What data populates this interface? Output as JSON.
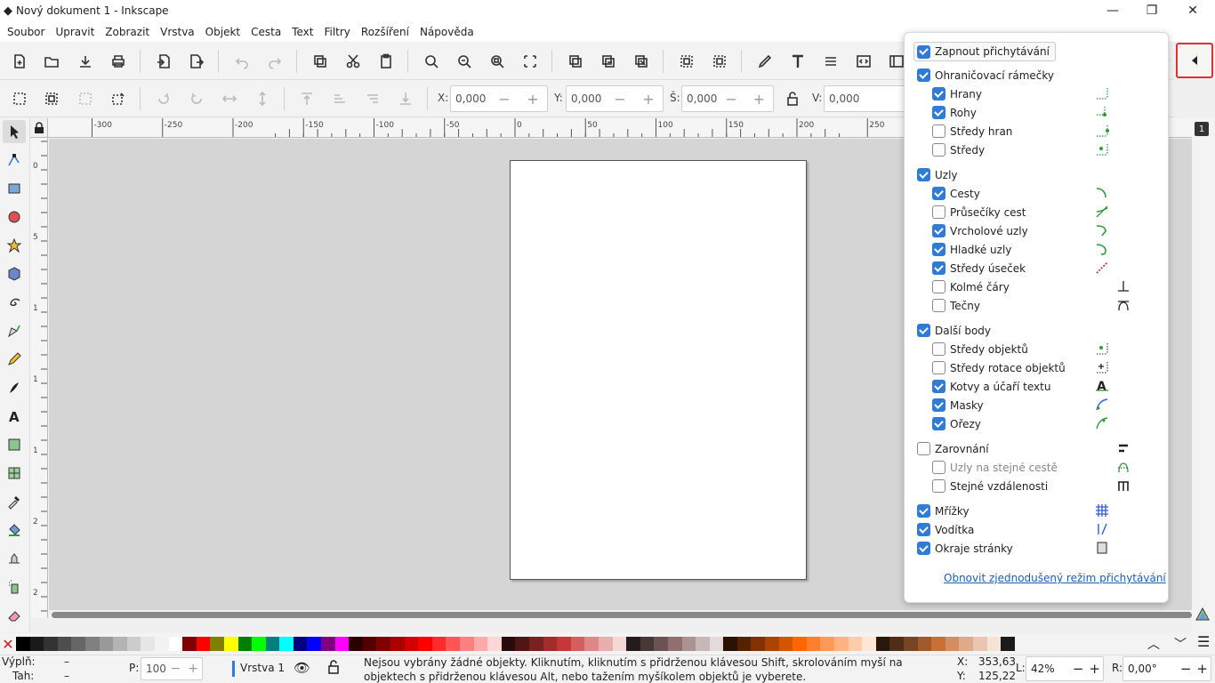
{
  "window": {
    "title": "Nový dokument 1 - Inkscape",
    "minimize": "—",
    "maximize": "❐",
    "close": "✕"
  },
  "menu": [
    "Soubor",
    "Upravit",
    "Zobrazit",
    "Vrstva",
    "Objekt",
    "Cesta",
    "Text",
    "Filtry",
    "Rozšíření",
    "Nápověda"
  ],
  "coords": {
    "x_label": "X:",
    "x_value": "0,000",
    "y_label": "Y:",
    "y_value": "0,000",
    "w_label": "Š:",
    "w_value": "0,000",
    "h_label": "V:",
    "h_value": "0,000"
  },
  "ruler": {
    "ticks": [
      "-300",
      "-250",
      "-200",
      "-150",
      "-100",
      "-50",
      "0",
      "50",
      "100",
      "150",
      "200",
      "250"
    ]
  },
  "vruler": {
    "ticks": [
      "0",
      "5",
      "1",
      "1",
      "1",
      "2",
      "2",
      "3"
    ]
  },
  "snap": {
    "toggle": "Zapnout přichytávání",
    "groups": [
      {
        "label": "Ohraničovací rámečky",
        "checked": true,
        "items": [
          {
            "label": "Hrany",
            "checked": true
          },
          {
            "label": "Rohy",
            "checked": true
          },
          {
            "label": "Středy hran",
            "checked": false
          },
          {
            "label": "Středy",
            "checked": false
          }
        ]
      },
      {
        "label": "Uzly",
        "checked": true,
        "items": [
          {
            "label": "Cesty",
            "checked": true
          },
          {
            "label": "Průsečíky cest",
            "checked": false
          },
          {
            "label": "Vrcholové uzly",
            "checked": true
          },
          {
            "label": "Hladké uzly",
            "checked": true
          },
          {
            "label": "Středy úseček",
            "checked": true
          },
          {
            "label": "Kolmé čáry",
            "checked": false
          },
          {
            "label": "Tečny",
            "checked": false
          }
        ]
      },
      {
        "label": "Další body",
        "checked": true,
        "items": [
          {
            "label": "Středy objektů",
            "checked": false
          },
          {
            "label": "Středy rotace objektů",
            "checked": false
          },
          {
            "label": "Kotvy a účaří textu",
            "checked": true
          },
          {
            "label": "Masky",
            "checked": true
          },
          {
            "label": "Ořezy",
            "checked": true
          }
        ]
      },
      {
        "label": "Zarovnání",
        "checked": false,
        "items": [
          {
            "label": "Uzly na stejné cestě",
            "checked": false
          },
          {
            "label": "Stejné vzdálenosti",
            "checked": false
          }
        ]
      }
    ],
    "extras": [
      {
        "label": "Mřížky",
        "checked": true
      },
      {
        "label": "Vodítka",
        "checked": true
      },
      {
        "label": "Okraje stránky",
        "checked": true
      }
    ],
    "reset_link": "Obnovit zjednodušený režim přichytávání"
  },
  "status": {
    "fill_label": "Výplň:",
    "fill_value": "–",
    "stroke_label": "Tah:",
    "stroke_value": "–",
    "opacity_label": "P:",
    "opacity_value": "100",
    "layer": "Vrstva 1",
    "message": "Nejsou vybrány žádné objekty. Kliknutím, kliknutím s přidrženou klávesou Shift, skrolováním myší na objektech s přidrženou klávesou Alt, nebo tažením myšíkolem objektů je vyberete.",
    "x_label": "X:",
    "x_value": "353,63",
    "y_label": "Y:",
    "y_value": "125,22",
    "zoom_label": "L:",
    "zoom_value": "42%",
    "rot_label": "R:",
    "rot_value": "0,00°"
  },
  "palette": [
    "#000000",
    "#1a1a1a",
    "#333333",
    "#4d4d4d",
    "#666666",
    "#808080",
    "#999999",
    "#b3b3b3",
    "#cccccc",
    "#e6e6e6",
    "#f2f2f2",
    "#ffffff",
    "#800000",
    "#ff0000",
    "#808000",
    "#ffff00",
    "#008000",
    "#00ff00",
    "#008080",
    "#00ffff",
    "#000080",
    "#0000ff",
    "#800080",
    "#ff00ff",
    "#2b0000",
    "#550000",
    "#800000",
    "#aa0000",
    "#d40000",
    "#ff0000",
    "#ff2a2a",
    "#ff5555",
    "#ff8080",
    "#ffaaaa",
    "#ffd5d5",
    "#280b0b",
    "#501616",
    "#782121",
    "#a02c2c",
    "#c83737",
    "#d35f5f",
    "#de8787",
    "#e9afaf",
    "#f4d7d7",
    "#241c1c",
    "#483737",
    "#6c5353",
    "#916f6f",
    "#ac9393",
    "#c8b7b7",
    "#e3dbdb",
    "#2b1100",
    "#552200",
    "#803300",
    "#aa4400",
    "#d45500",
    "#ff6600",
    "#ff7f2a",
    "#ff9955",
    "#ffb380",
    "#ffccaa",
    "#ffe6d5",
    "#28170b",
    "#502d16",
    "#784421",
    "#a05a2c",
    "#c87137",
    "#d38d5f",
    "#deaa87",
    "#e9c6af",
    "#f4e3d7",
    "#1a1a1a"
  ]
}
